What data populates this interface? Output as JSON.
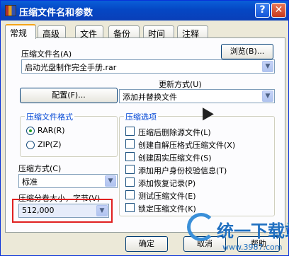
{
  "window": {
    "title": "压缩文件名和参数",
    "help_glyph": "?",
    "close_glyph": "✕"
  },
  "tabs": [
    {
      "label": "常规",
      "active": true
    },
    {
      "label": "高级"
    },
    {
      "label": "文件"
    },
    {
      "label": "备份"
    },
    {
      "label": "时间"
    },
    {
      "label": "注释"
    }
  ],
  "archive_name": {
    "label": "压缩文件名(A)",
    "value": "启动光盘制作完全手册.rar",
    "browse_label": "浏览(B)..."
  },
  "profiles_button": "配置(F)...",
  "update_mode": {
    "label": "更新方式(U)",
    "value": "添加并替换文件"
  },
  "archive_format": {
    "title": "压缩文件格式",
    "options": [
      {
        "label": "RAR(R)",
        "selected": true
      },
      {
        "label": "ZIP(Z)",
        "selected": false
      }
    ]
  },
  "compression_method": {
    "label": "压缩方式(C)",
    "value": "标准"
  },
  "split_volumes": {
    "label": "压缩分卷大小，字节(V)",
    "value": "512,000"
  },
  "archiving_options": {
    "title": "压缩选项",
    "items": [
      "压缩后删除源文件(L)",
      "创建自解压格式压缩文件(X)",
      "创建固实压缩文件(S)",
      "添加用户身份校验信息(T)",
      "添加恢复记录(P)",
      "测试压缩文件(E)",
      "锁定压缩文件(K)"
    ]
  },
  "footer": {
    "ok": "确定",
    "cancel": "取消",
    "help": "帮助"
  },
  "watermark": {
    "text": "统一下载站",
    "url": "www.3987.com"
  },
  "colors": {
    "accent_title": "#0547c4",
    "highlight_box": "#e02020",
    "group_title": "#0046d5"
  }
}
